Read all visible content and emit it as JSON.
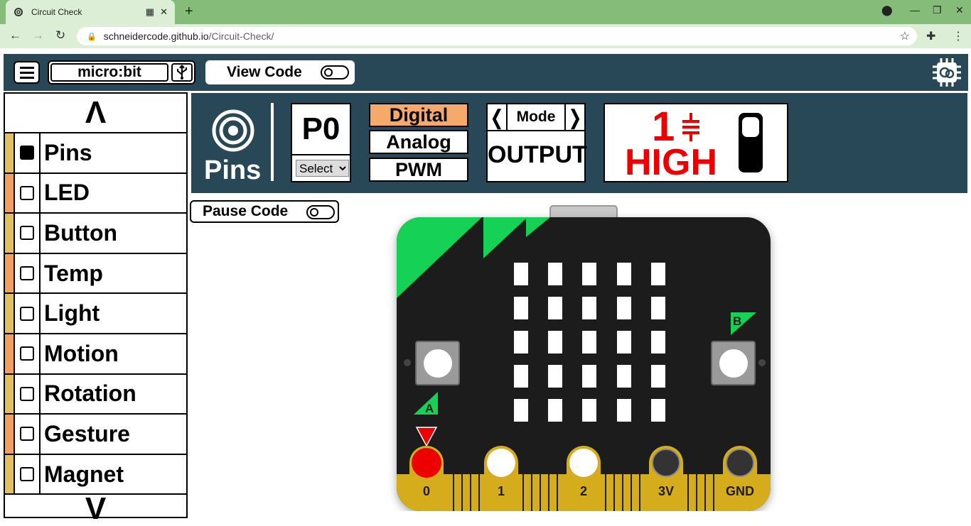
{
  "browser": {
    "tab_title": "Circuit Check",
    "url_host": "schneidercode.github.io",
    "url_path": "/Circuit-Check/"
  },
  "header": {
    "device": "micro:bit",
    "view_code_label": "View Code"
  },
  "sidebar": {
    "up_arrow": "Λ",
    "down_arrow": "V",
    "items": [
      {
        "label": "Pins",
        "checked": true,
        "color": "#e0c060"
      },
      {
        "label": "LED",
        "checked": false,
        "color": "#f0a060"
      },
      {
        "label": "Button",
        "checked": false,
        "color": "#e0c060"
      },
      {
        "label": "Temp",
        "checked": false,
        "color": "#f0a060"
      },
      {
        "label": "Light",
        "checked": false,
        "color": "#e0c060"
      },
      {
        "label": "Motion",
        "checked": false,
        "color": "#f0a060"
      },
      {
        "label": "Rotation",
        "checked": false,
        "color": "#e0c060"
      },
      {
        "label": "Gesture",
        "checked": false,
        "color": "#f0a060"
      },
      {
        "label": "Magnet",
        "checked": false,
        "color": "#e0c060"
      }
    ]
  },
  "pins_panel": {
    "title": "Pins",
    "pin_name": "P0",
    "select_label": "Select",
    "modes": [
      "Digital",
      "Analog",
      "PWM"
    ],
    "active_mode": "Digital",
    "io_mode_label": "Mode",
    "io_mode_value": "OUTPUT",
    "state_value": "1",
    "state_label": "HIGH"
  },
  "pause_code_label": "Pause Code",
  "microbit": {
    "button_a": "A",
    "button_b": "B",
    "pins": [
      "0",
      "1",
      "2",
      "3V",
      "GND"
    ]
  },
  "colors": {
    "header_bg": "#284857",
    "active_mode": "#f5a96b",
    "high": "#ee0000",
    "board": "#1c1c1c",
    "board_accent": "#15d155",
    "gold": "#d4ac1c"
  }
}
